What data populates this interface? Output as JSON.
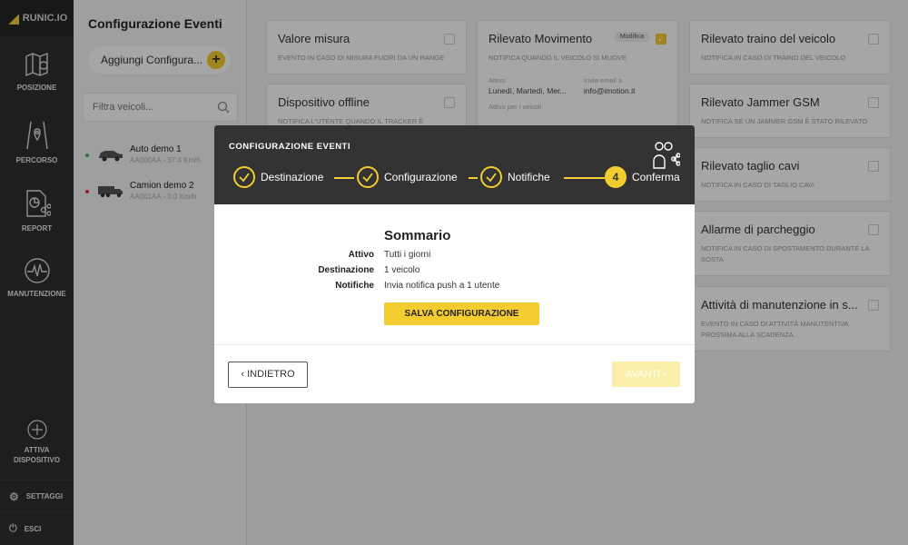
{
  "brand": {
    "name": "RUNIC.IO",
    "accent": "#f3cc30"
  },
  "nav": {
    "items": [
      {
        "label": "POSIZIONE",
        "icon": "map-icon"
      },
      {
        "label": "PERCORSO",
        "icon": "route-icon"
      },
      {
        "label": "REPORT",
        "icon": "report-icon"
      },
      {
        "label": "MANUTENZIONE",
        "icon": "pulse-icon"
      }
    ],
    "activate_line1": "ATTIVA",
    "activate_line2": "DISPOSITIVO",
    "settings": "SETTAGGI",
    "logout": "ESCI"
  },
  "vehicles_panel": {
    "title": "Configurazione Eventi",
    "add_label": "Aggiungi Configura...",
    "filter_placeholder": "Filtra veicoli...",
    "vehicles": [
      {
        "name": "Auto demo 1",
        "sub": "AA000AA - 37.4 Km/h",
        "status_color": "#4caf50"
      },
      {
        "name": "Camion demo 2",
        "sub": "AA001AA - 0.0 Km/h",
        "status_color": "#e53935"
      }
    ]
  },
  "cards": {
    "valore": {
      "title": "Valore misura",
      "desc": "EVENTO IN CASO DI MISURA FUORI DA UN RANGE"
    },
    "offline": {
      "title": "Dispositivo offline",
      "desc": "NOTIFICA L'UTENTE QUANDO IL TRACKER È"
    },
    "movimento": {
      "title": "Rilevato Movimento",
      "modifica": "Modifica",
      "desc": "NOTIFICA QUANDO IL VEICOLO SI MUOVE",
      "attivo_label": "Attivo",
      "attivo_value": "Lunedì, Martedì, Mer...",
      "email_label": "Invia email a",
      "email_value": "info@imotion.it",
      "veicoli_label": "Attivo per i veicoli"
    },
    "traino": {
      "title": "Rilevato traino del veicolo",
      "desc": "NOTIFICA IN CASO DI TRAINO DEL VEICOLO"
    },
    "jammer": {
      "title": "Rilevato Jammer GSM",
      "desc": "NOTIFICA SE UN JAMMER GSM È STATO RILEVATO"
    },
    "cavi": {
      "title": "Rilevato taglio cavi",
      "desc": "NOTIFICA IN CASO DI TAGLIO CAVI"
    },
    "parcheggio": {
      "title": "Allarme di parcheggio",
      "desc": "NOTIFICA IN CASO DI SPOSTAMENTO DURANTE LA SOSTA"
    },
    "manutenzione": {
      "title": "Attività di manutenzione in s...",
      "desc": "EVENTO IN CASO DI ATTIVITÀ MANUTENTIVA PROSSIMA ALLA SCADENZA."
    }
  },
  "modal": {
    "title": "CONFIGURAZIONE EVENTI",
    "steps": [
      {
        "label": "Destinazione",
        "done": true
      },
      {
        "label": "Configurazione",
        "done": true
      },
      {
        "label": "Notifiche",
        "done": true
      },
      {
        "label": "Conferma",
        "number": "4"
      }
    ],
    "summary_title": "Sommario",
    "summary": [
      {
        "key": "Attivo",
        "value": "Tutti i giorni"
      },
      {
        "key": "Destinazione",
        "value": "1 veicolo"
      },
      {
        "key": "Notifiche",
        "value": "Invia notifica push a 1 utente"
      }
    ],
    "save_label": "SALVA CONFIGURAZIONE",
    "back_label": "INDIETRO",
    "next_label": "AVANTI"
  }
}
